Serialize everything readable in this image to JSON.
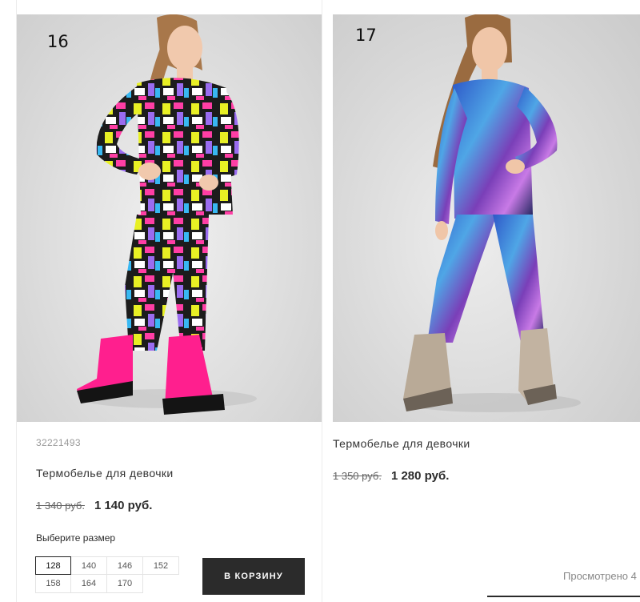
{
  "products": [
    {
      "badge": "16",
      "article": "32221493",
      "name": "Термобелье для девочки",
      "old_price": "1 340 руб.",
      "new_price": "1 140 руб.",
      "size_label": "Выберите размер",
      "sizes": [
        "128",
        "140",
        "146",
        "152",
        "158",
        "164",
        "170"
      ],
      "selected_size": "128",
      "cart_button": "В КОРЗИНУ"
    },
    {
      "badge": "17",
      "name": "Термобелье для девочки",
      "old_price": "1 350 руб.",
      "new_price": "1 280 руб."
    }
  ],
  "viewed_text": "Просмотрено 4",
  "colors": {
    "button_bg": "#2b2b2b",
    "price_text": "#2b2b2b",
    "muted_text": "#9a9a9a"
  }
}
